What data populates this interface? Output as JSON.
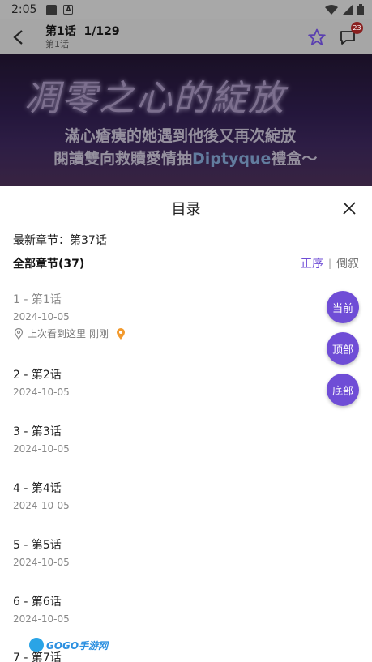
{
  "status_bar": {
    "time": "2:05"
  },
  "header": {
    "title": "第1话",
    "page_count": "1/129",
    "subtitle": "第1话",
    "badge_count": "23"
  },
  "banner": {
    "title": "凋零之心的綻放",
    "line1": "滿心瘡痍的她遇到他後又再次綻放",
    "line2_prefix": "閱讀雙向救贖愛情抽",
    "line2_highlight": "Diptyque",
    "line2_suffix": "禮盒～"
  },
  "sheet": {
    "title": "目录",
    "latest": "最新章节：第37话",
    "all_label": "全部章节(37)",
    "order_asc": "正序",
    "order_sep": "|",
    "order_desc": "倒叙",
    "last_read_label": "上次看到这里",
    "last_read_time": "刚刚"
  },
  "chapters": [
    {
      "name": "1 - 第1话",
      "date": "2024-10-05"
    },
    {
      "name": "2 - 第2话",
      "date": "2024-10-05"
    },
    {
      "name": "3 - 第3话",
      "date": "2024-10-05"
    },
    {
      "name": "4 - 第4话",
      "date": "2024-10-05"
    },
    {
      "name": "5 - 第5话",
      "date": "2024-10-05"
    },
    {
      "name": "6 - 第6话",
      "date": "2024-10-05"
    },
    {
      "name": "7 - 第7话",
      "date": ""
    }
  ],
  "fabs": {
    "current": "当前",
    "top": "顶部",
    "bottom": "底部"
  },
  "watermark": {
    "text": "GOGO手游网"
  },
  "colors": {
    "accent": "#6f4dd6",
    "dim_overlay": "#a6a6a6"
  }
}
